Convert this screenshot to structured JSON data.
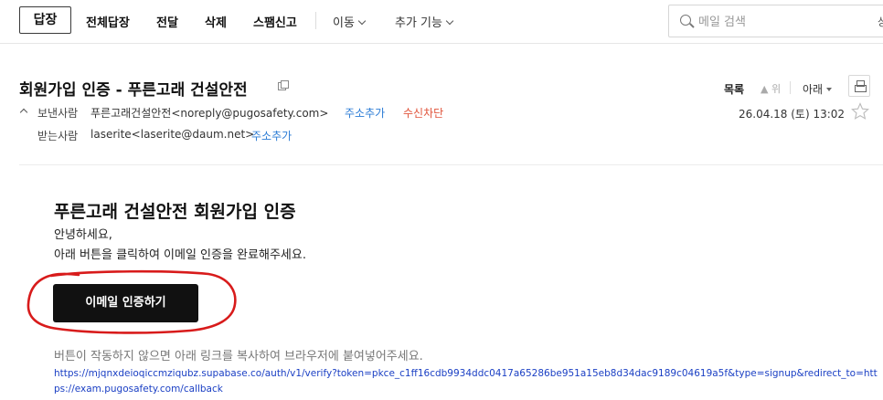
{
  "toolbar": {
    "reply": "답장",
    "reply_all": "전체답장",
    "forward": "전달",
    "delete": "삭제",
    "spam": "스팸신고",
    "move": "이동",
    "more": "추가 기능",
    "search_placeholder": "메일 검색",
    "search_detail": "상세"
  },
  "message": {
    "subject": "회원가입 인증 - 푸른고래 건설안전",
    "nav": {
      "list": "목록",
      "up": "위",
      "down": "아래"
    },
    "sender_label": "보낸사람",
    "sender_address": "푸른고래건설안전<noreply@pugosafety.com>",
    "add_contact": "주소추가",
    "block_sender": "수신차단",
    "recipient_label": "받는사람",
    "recipient_address": "laserite<laserite@daum.net>",
    "add_contact_2": "주소추가",
    "date": "26.04.18 (토) 13:02"
  },
  "body": {
    "title": "푸른고래 건설안전 회원가입 인증",
    "greeting": "안녕하세요,",
    "instruction": "아래 버튼을 클릭하여 이메일 인증을 완료해주세요.",
    "verify_button": "이메일 인증하기",
    "fallback_text": "버튼이 작동하지 않으면 아래 링크를 복사하여 브라우저에 붙여넣어주세요.",
    "verify_url": "https://mjqnxdeioqiccmziqubz.supabase.co/auth/v1/verify?token=pkce_c1ff16cdb9934ddc0417a65286be951a15eb8d34dac9189c04619a5f&type=signup&redirect_to=https://exam.pugosafety.com/callback"
  },
  "colors": {
    "link_blue": "#2a7bd5",
    "block_red": "#e0533a",
    "url_blue": "#1a3fc4",
    "annotation_red": "#d81b1b"
  }
}
